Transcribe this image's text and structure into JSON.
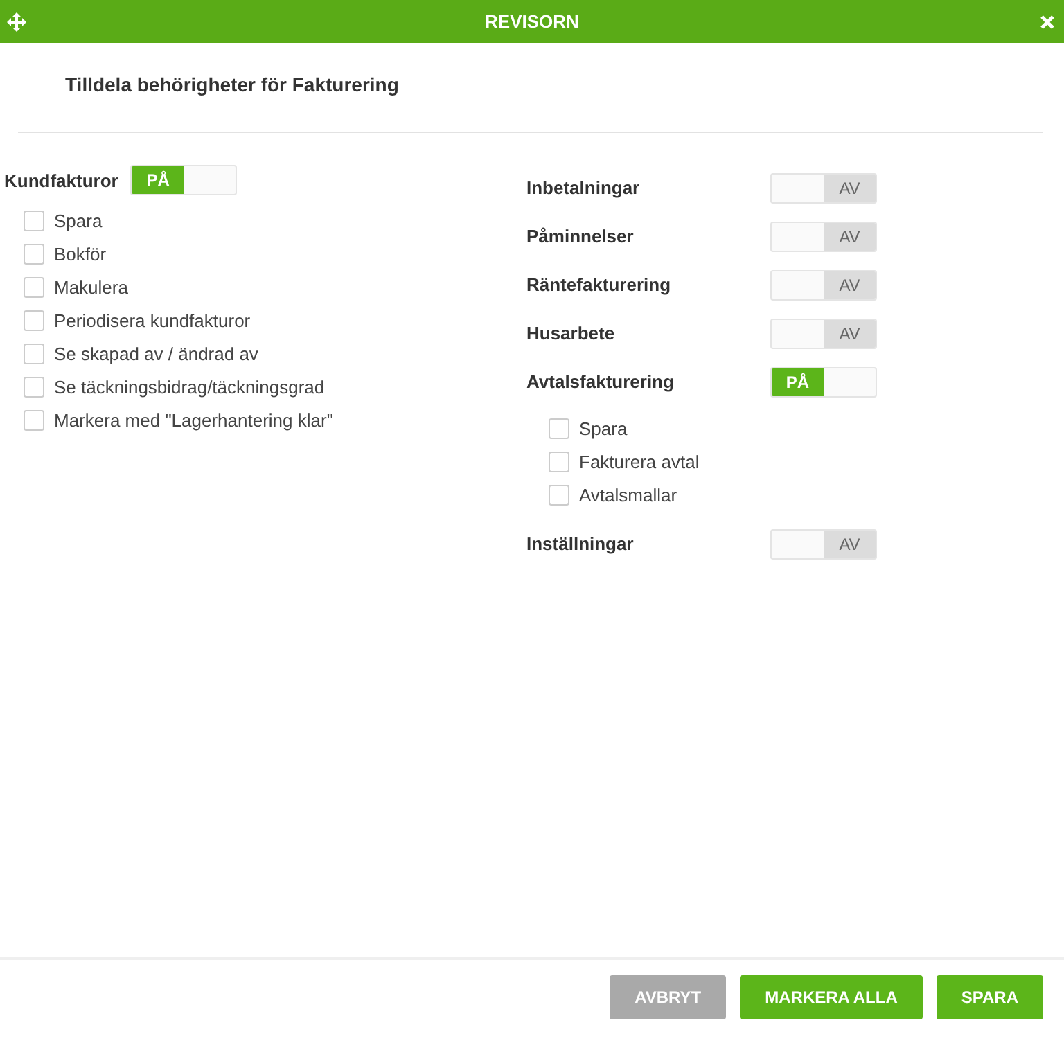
{
  "window": {
    "title": "REVISORN"
  },
  "heading": "Tilldela behörigheter för Fakturering",
  "columns": [
    {
      "sections": [
        {
          "label": "Kundfakturor",
          "toggle": {
            "on": true,
            "text": "PÅ"
          },
          "options": [
            {
              "label": "Spara",
              "checked": false
            },
            {
              "label": "Bokför",
              "checked": false
            },
            {
              "label": "Makulera",
              "checked": false
            },
            {
              "label": "Periodisera kundfakturor",
              "checked": false
            },
            {
              "label": "Se skapad av / ändrad av",
              "checked": false
            },
            {
              "label": "Se täckningsbidrag/täckningsgrad",
              "checked": false
            },
            {
              "label": "Markera med \"Lagerhantering klar\"",
              "checked": false
            }
          ]
        }
      ]
    },
    {
      "sections": [
        {
          "label": "Inbetalningar",
          "toggle": {
            "on": false,
            "text": "AV"
          }
        },
        {
          "label": "Påminnelser",
          "toggle": {
            "on": false,
            "text": "AV"
          }
        },
        {
          "label": "Räntefakturering",
          "toggle": {
            "on": false,
            "text": "AV"
          }
        },
        {
          "label": "Husarbete",
          "toggle": {
            "on": false,
            "text": "AV"
          }
        },
        {
          "label": "Avtalsfakturering",
          "toggle": {
            "on": true,
            "text": "PÅ"
          },
          "options": [
            {
              "label": "Spara",
              "checked": false
            },
            {
              "label": "Fakturera avtal",
              "checked": false
            },
            {
              "label": "Avtalsmallar",
              "checked": false
            }
          ]
        },
        {
          "label": "Inställningar",
          "toggle": {
            "on": false,
            "text": "AV"
          }
        }
      ]
    }
  ],
  "buttons": [
    {
      "label": "AVBRYT",
      "kind": "cancel"
    },
    {
      "label": "MARKERA ALLA",
      "kind": "primary"
    },
    {
      "label": "SPARA",
      "kind": "primary"
    }
  ]
}
